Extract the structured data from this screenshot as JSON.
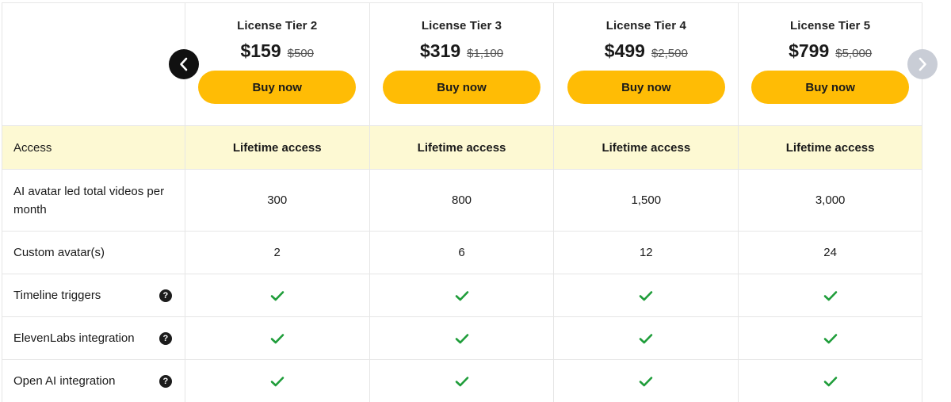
{
  "tiers": [
    {
      "name": "License Tier 2",
      "price": "$159",
      "old_price": "$500",
      "button": "Buy now"
    },
    {
      "name": "License Tier 3",
      "price": "$319",
      "old_price": "$1,100",
      "button": "Buy now"
    },
    {
      "name": "License Tier 4",
      "price": "$499",
      "old_price": "$2,500",
      "button": "Buy now"
    },
    {
      "name": "License Tier 5",
      "price": "$799",
      "old_price": "$5,000",
      "button": "Buy now"
    }
  ],
  "rows": {
    "access": {
      "label": "Access",
      "values": [
        "Lifetime access",
        "Lifetime access",
        "Lifetime access",
        "Lifetime access"
      ]
    },
    "videos": {
      "label": "AI avatar led total videos per month",
      "values": [
        "300",
        "800",
        "1,500",
        "3,000"
      ]
    },
    "avatars": {
      "label": "Custom avatar(s)",
      "values": [
        "2",
        "6",
        "12",
        "24"
      ]
    },
    "timeline": {
      "label": "Timeline triggers",
      "icon": "help-icon",
      "values_icon": "check-icon"
    },
    "elevenlabs": {
      "label": "ElevenLabs integration",
      "icon": "help-icon",
      "values_icon": "check-icon"
    },
    "openai": {
      "label": "Open AI integration",
      "icon": "help-icon",
      "values_icon": "check-icon"
    }
  },
  "icons": {
    "help_glyph": "?",
    "prev": "chevron-left-icon",
    "next": "chevron-right-icon"
  },
  "colors": {
    "accent_button": "#ffbc05",
    "highlight_row": "#fdf9d3",
    "check": "#1f9d3a",
    "nav_prev": "#111111",
    "nav_next": "#c9cdd6"
  }
}
